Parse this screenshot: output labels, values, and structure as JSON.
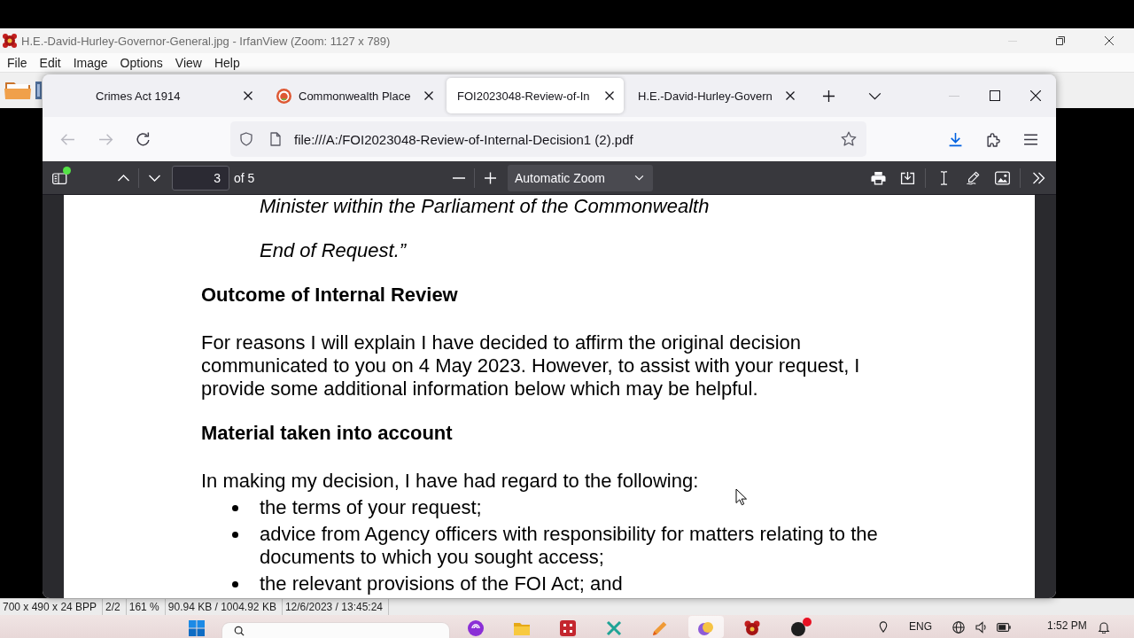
{
  "irfanview": {
    "title": "H.E.-David-Hurley-Governor-General.jpg - IrfanView (Zoom: 1127 x 789)",
    "minimize_dimmed": true,
    "menu": [
      "File",
      "Edit",
      "Image",
      "Options",
      "View",
      "Help"
    ],
    "status_bar": [
      "700 x 490 x 24 BPP",
      "2/2",
      "161 %",
      "90.94 KB / 1004.92 KB",
      "12/6/2023 / 13:45:24"
    ]
  },
  "browser": {
    "tabs": [
      {
        "title": "Crimes Act 1914",
        "favicon": false,
        "selected": false
      },
      {
        "title": "Commonwealth Place",
        "favicon": true,
        "selected": false
      },
      {
        "title": "FOI2023048-Review-of-In",
        "favicon": false,
        "selected": true
      },
      {
        "title": "H.E.-David-Hurley-Govern",
        "favicon": false,
        "selected": false
      }
    ],
    "minimize_dimmed": true,
    "navigation": {
      "back_disabled": true,
      "forward_disabled": true
    },
    "address_bar": {
      "value": "file:///A:/FOI2023048-Review-of-Internal-Decision1 (2).pdf"
    },
    "pdf_toolbar": {
      "sidebar_notification": true,
      "page_number": "3",
      "page_count": "of 5",
      "zoom": "Automatic Zoom"
    },
    "document": [
      {
        "kind": "quote",
        "text": "Minister within the Parliament of the Commonwealth"
      },
      {
        "kind": "quote",
        "text": "End of Request.”"
      },
      {
        "kind": "heading",
        "text": "Outcome of Internal Review"
      },
      {
        "kind": "paragraph",
        "text": "For reasons I will explain I have decided to affirm the original decision communicated to you on 4 May 2023. However, to assist with your request, I provide some additional information below which may be helpful."
      },
      {
        "kind": "heading",
        "text": "Material taken into account"
      },
      {
        "kind": "paragraph",
        "text": "In making my decision, I have had regard to the following:"
      },
      {
        "kind": "bullet",
        "text": "the terms of your request;"
      },
      {
        "kind": "bullet",
        "text": "advice from Agency officers with responsibility for matters relating to the documents to which you sought access;"
      },
      {
        "kind": "bullet",
        "text": "the relevant provisions of the FOI Act; and"
      }
    ]
  },
  "taskbar": {
    "apps": [
      {
        "selected": false,
        "badge": false
      },
      {
        "selected": false,
        "badge": false
      },
      {
        "selected": false,
        "badge": false
      },
      {
        "selected": false,
        "badge": false
      },
      {
        "selected": false,
        "badge": false
      },
      {
        "selected": true,
        "badge": false
      },
      {
        "selected": false,
        "badge": false
      },
      {
        "selected": false,
        "badge": true
      }
    ],
    "language": "ENG",
    "clock": "1:52 PM"
  }
}
